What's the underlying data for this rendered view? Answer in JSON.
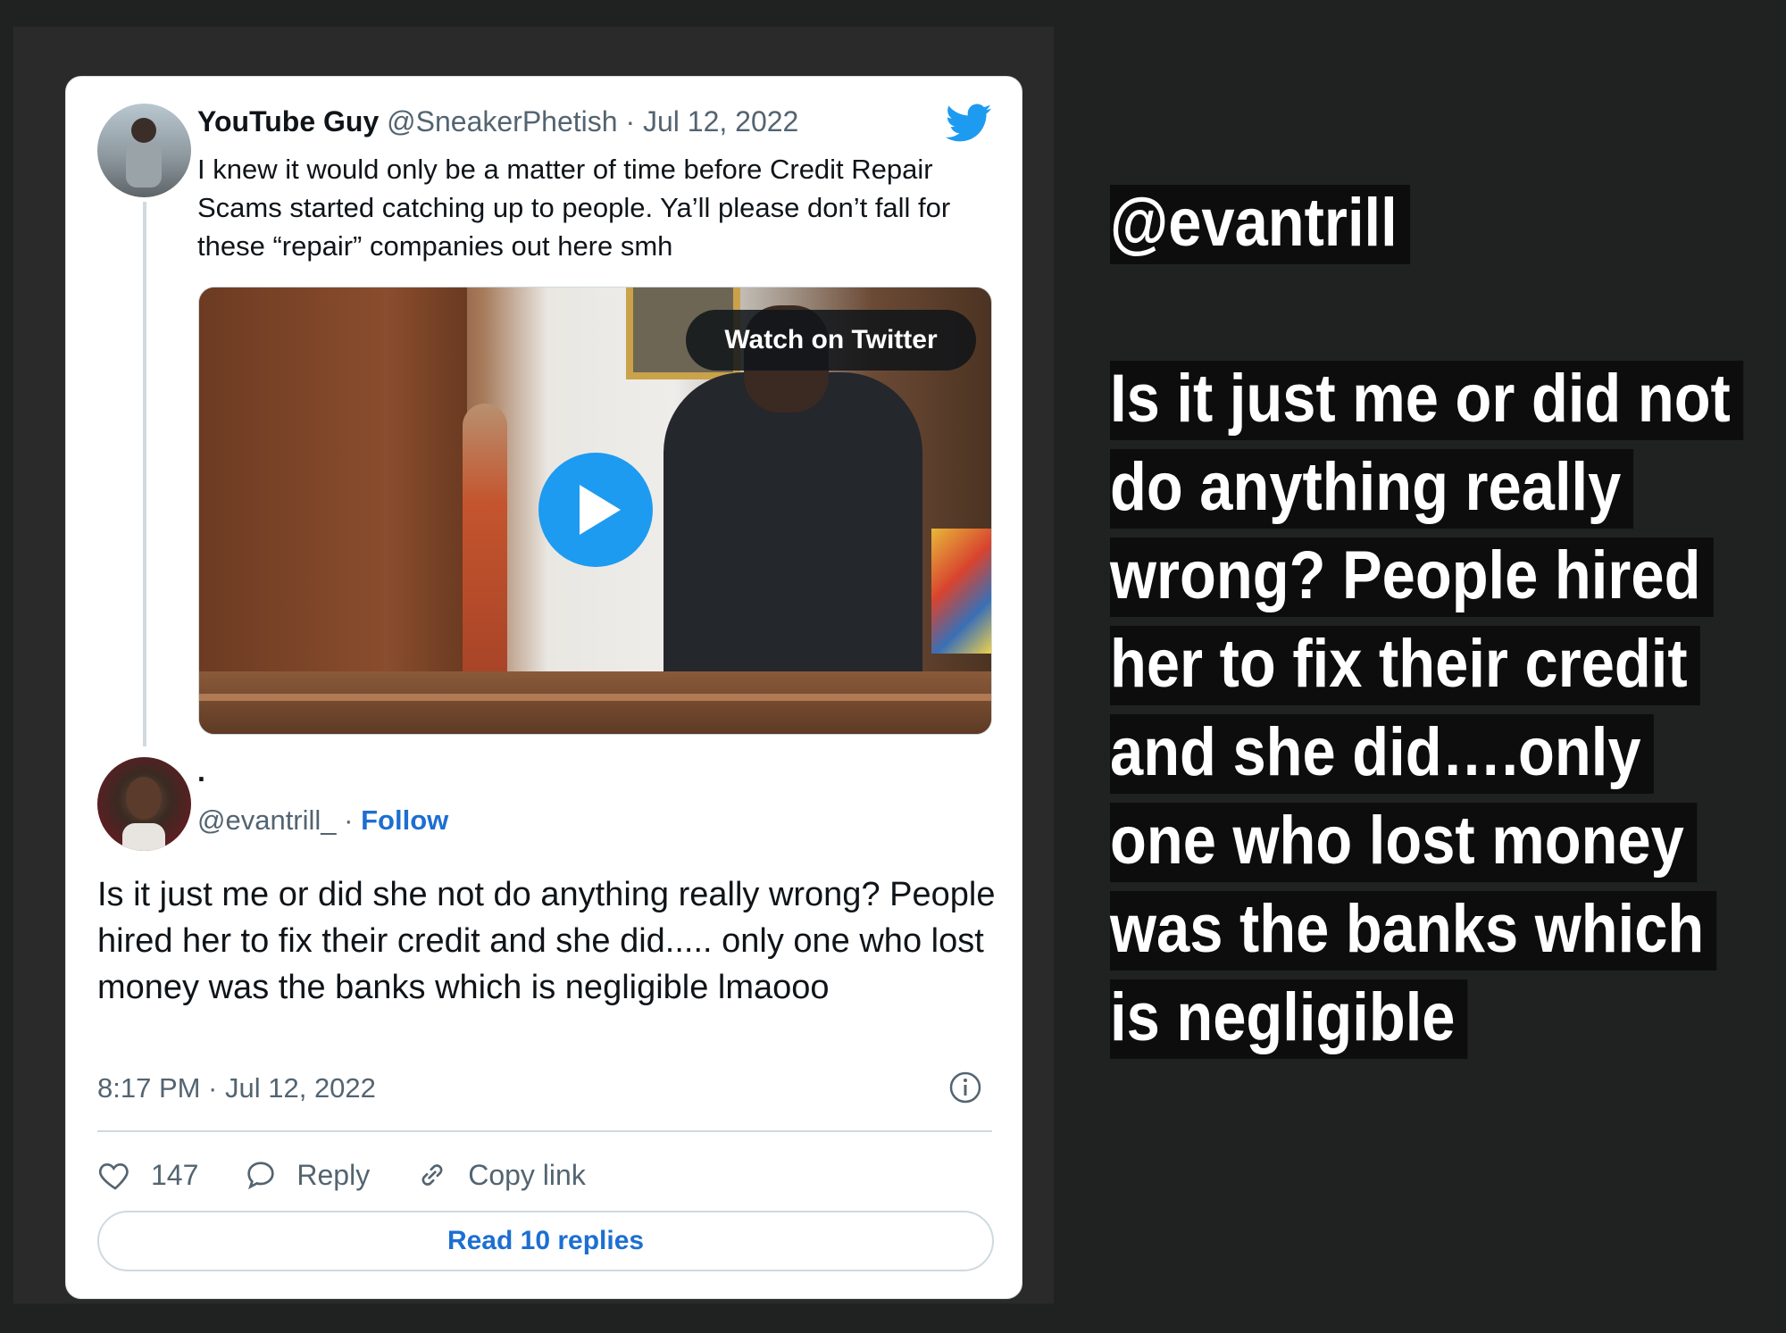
{
  "embed": {
    "tweet1": {
      "display_name": "YouTube Guy",
      "handle": "@SneakerPhetish",
      "date": "Jul 12, 2022",
      "text": "I knew it would only be a matter of time before Credit Repair Scams started catching up to people. Ya’ll please don’t fall for these “repair” companies out here smh",
      "video_button": "Watch on Twitter"
    },
    "tweet2": {
      "display_name": ".",
      "handle": "@evantrill_",
      "follow_label": "Follow",
      "text": "Is it just me or did she not do anything really wrong? People hired her to fix their credit and she did..... only one who lost money was the banks which is negligible lmaooo",
      "timestamp": "8:17 PM · Jul 12, 2022",
      "likes": "147",
      "reply_label": "Reply",
      "copy_link_label": "Copy link",
      "read_replies_label": "Read 10 replies"
    }
  },
  "caption": {
    "handle": "@evantrill",
    "text": "Is it just me or did not do anything really wrong? People hired her to fix their credit and she did….only one who lost money was the banks which is negligible"
  },
  "colors": {
    "background": "#202221",
    "twitter_blue": "#1d9bf0",
    "link_blue": "#1d6fd1",
    "caption_highlight": "#0d0d0d"
  },
  "icons": [
    "twitter-bird-icon",
    "play-icon",
    "info-icon",
    "heart-icon",
    "reply-icon",
    "link-icon"
  ]
}
